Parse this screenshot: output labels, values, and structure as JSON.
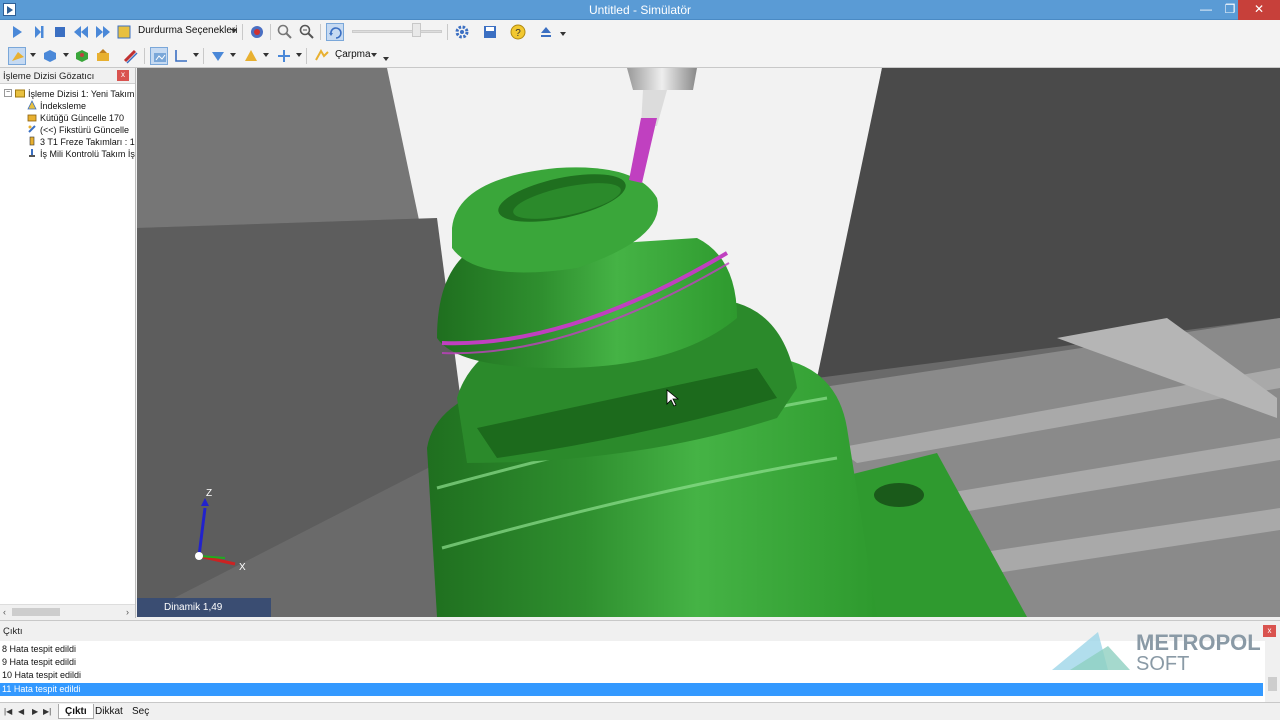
{
  "window": {
    "title": "Untitled - Simülatör",
    "min": "—",
    "max": "❐",
    "close": "✕"
  },
  "toolbar1": {
    "stop_options_label": "Durdurma Seçenekleri",
    "icons": [
      "play-icon",
      "step-icon",
      "stop-icon",
      "rewind-icon",
      "fast-forward-icon",
      "notes-icon",
      "record-icon",
      "zoom-icon",
      "zoom-fit-icon",
      "rotate-view-icon",
      "settings-icon",
      "save-icon",
      "help-icon",
      "eject-icon"
    ]
  },
  "toolbar2": {
    "collision_label": "Çarpma"
  },
  "left_panel": {
    "title": "İşleme Dizisi Gözatıcı",
    "close": "x",
    "expander": "−",
    "tree": [
      {
        "label": "İşleme Dizisi 1: Yeni Takım",
        "icon": "sequence-icon",
        "indent": 0
      },
      {
        "label": "İndeksleme",
        "icon": "index-icon",
        "indent": 1
      },
      {
        "label": "Kütüğü Güncelle 170",
        "icon": "stock-icon",
        "indent": 1
      },
      {
        "label": "(<<) Fikstürü Güncelle",
        "icon": "fixture-icon",
        "indent": 1
      },
      {
        "label": "3 T1 Freze Takımları : 1",
        "icon": "tool-icon",
        "indent": 1
      },
      {
        "label": "İş Mili Kontrolü Takım İş",
        "icon": "spindle-icon",
        "indent": 1
      }
    ]
  },
  "viewport": {
    "status": "Dinamik 1,49",
    "axis_z": "Z",
    "axis_x": "X"
  },
  "output": {
    "title": "Çıktı",
    "close": "x",
    "rows": [
      {
        "text": "8 Hata tespit edildi",
        "selected": false
      },
      {
        "text": "9 Hata tespit edildi",
        "selected": false
      },
      {
        "text": "10 Hata tespit edildi",
        "selected": false
      },
      {
        "text": "11 Hata tespit edildi",
        "selected": true
      }
    ]
  },
  "logo": {
    "line1": "METROPOL",
    "line2": "SOFT"
  },
  "tabs": [
    {
      "label": "Çıktı",
      "active": true
    },
    {
      "label": "Dikkat",
      "active": false
    },
    {
      "label": "Seç",
      "active": false
    }
  ],
  "colors": {
    "titlebar": "#5a9bd5",
    "part_green": "#3aa63a",
    "tool_magenta": "#c040c0",
    "selection": "#3399ff"
  }
}
